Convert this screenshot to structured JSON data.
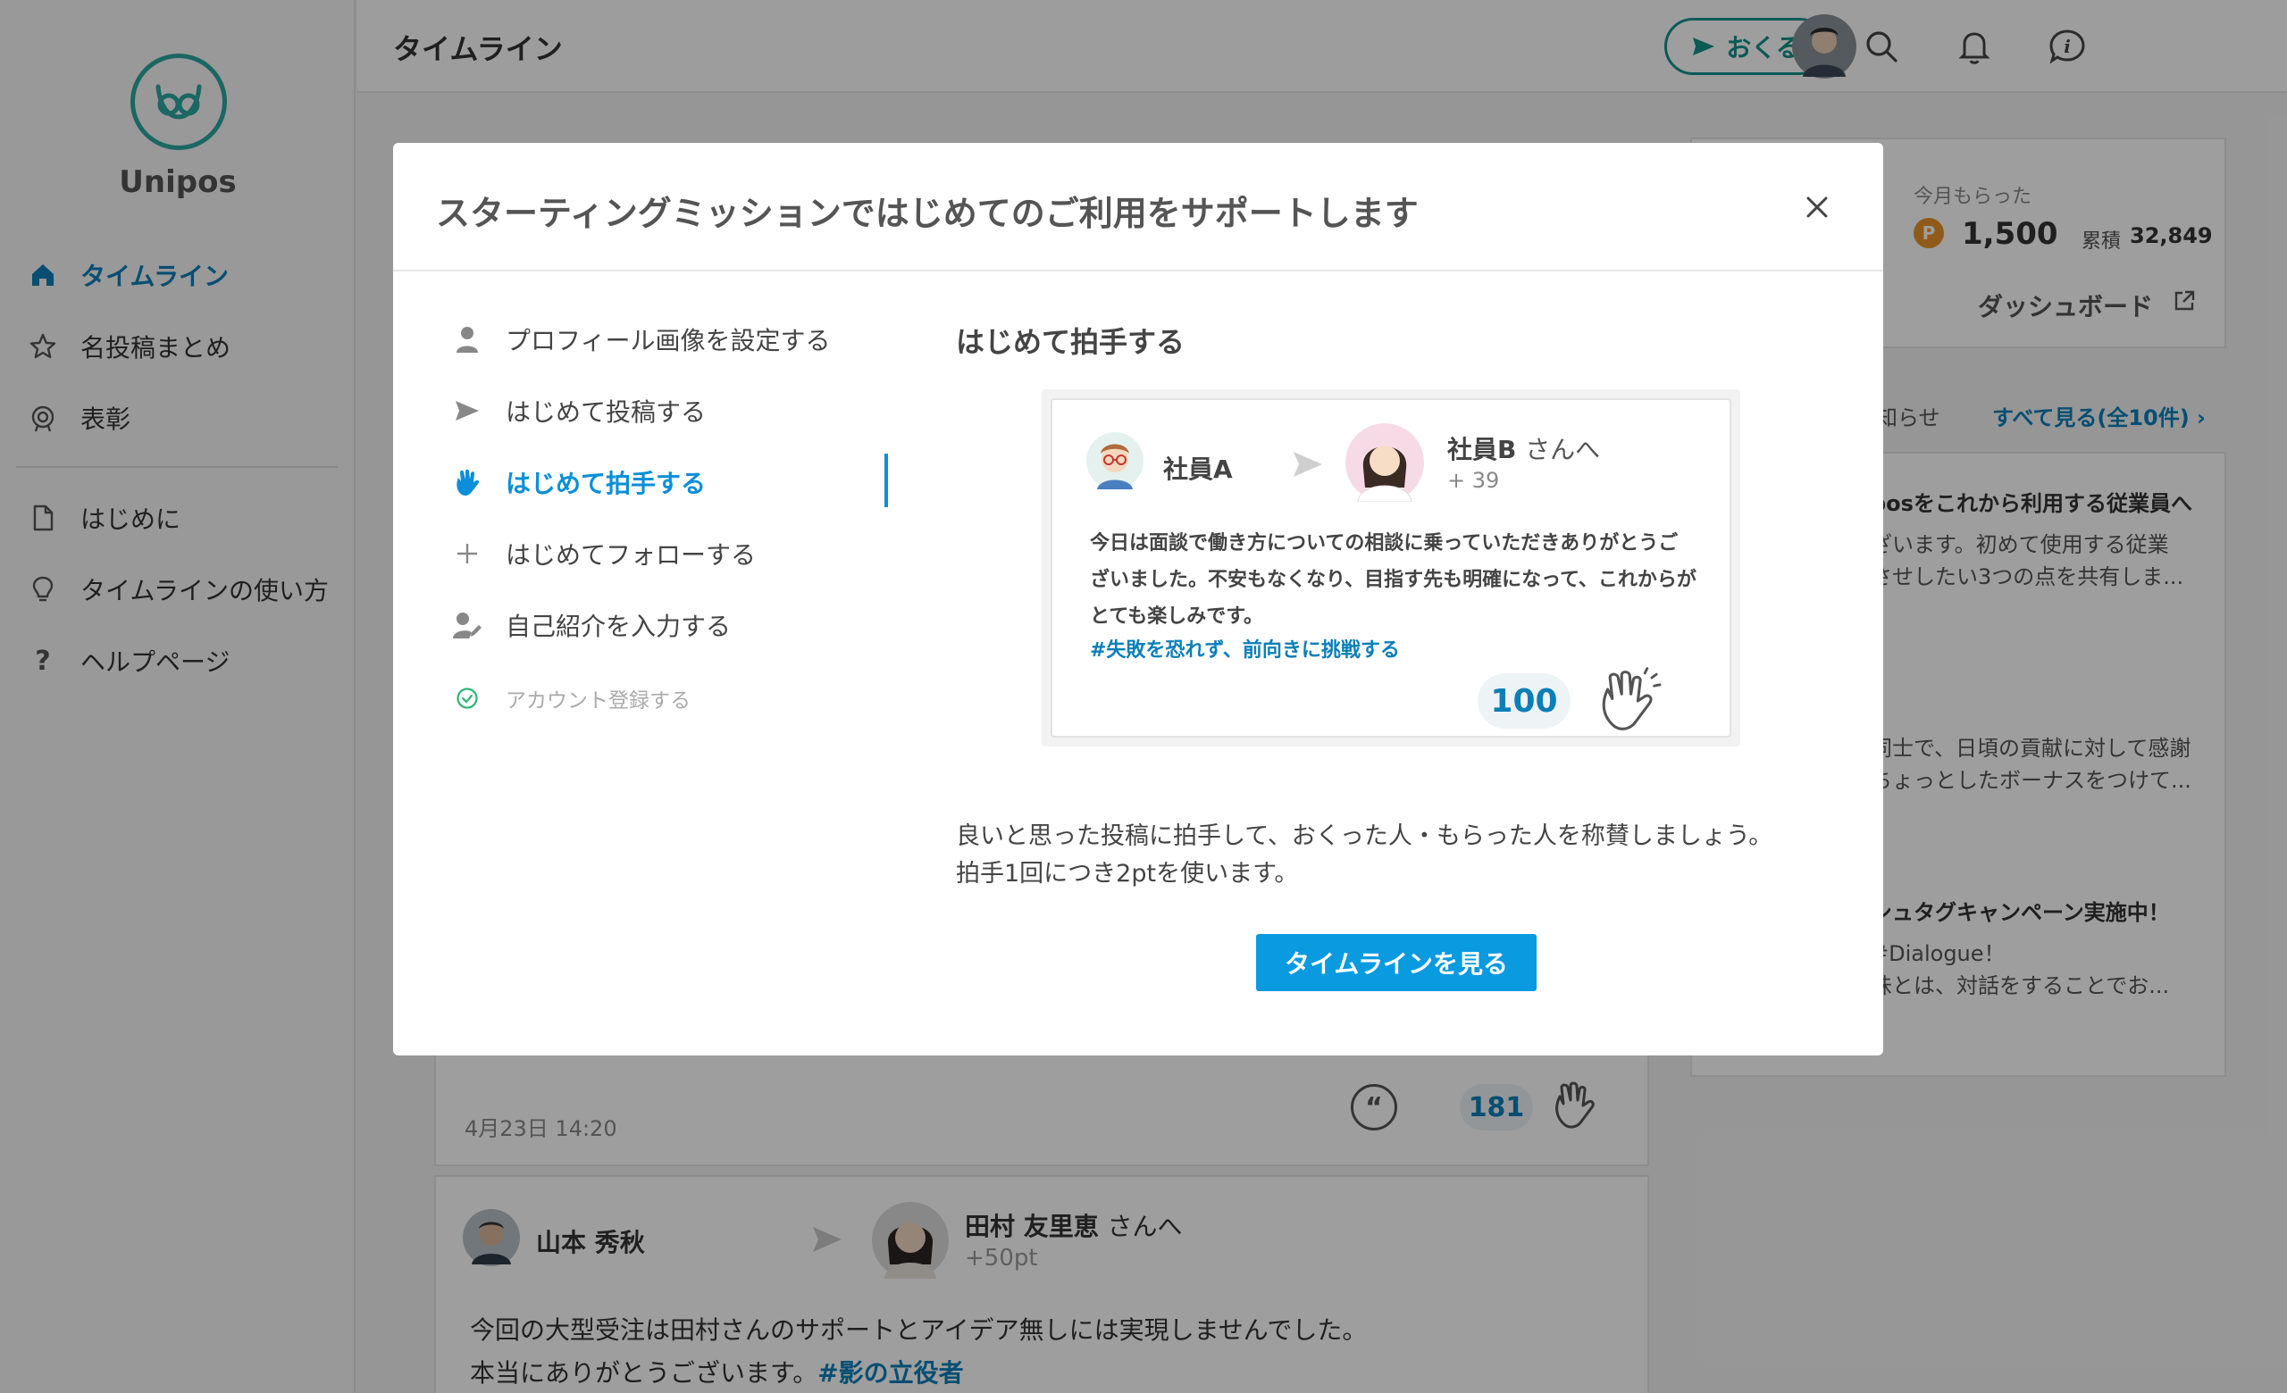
{
  "app": {
    "name": "Unipos"
  },
  "sidebar": {
    "items": [
      {
        "label": "タイムライン",
        "icon": "home-icon",
        "active": true
      },
      {
        "label": "名投稿まとめ",
        "icon": "star-icon"
      },
      {
        "label": "表彰",
        "icon": "award-icon"
      },
      {
        "label": "はじめに",
        "icon": "document-icon"
      },
      {
        "label": "タイムラインの使い方",
        "icon": "lightbulb-icon"
      },
      {
        "label": "ヘルプページ",
        "icon": "question-icon"
      }
    ]
  },
  "header": {
    "title": "タイムライン",
    "send_label": "おくる",
    "icons": [
      "search-icon",
      "bell-icon",
      "info-icon",
      "avatar"
    ]
  },
  "points_card": {
    "label": "今月もらった",
    "point_icon": "P",
    "points": "1,500",
    "total_label": "累積",
    "total": "32,849",
    "dashboard_label": "ダッシュボード"
  },
  "news": {
    "heading": "知らせ",
    "see_all": "すべて見る(全10件)",
    "items": [
      {
        "title": "posをこれから利用する従業員へ",
        "lines": [
          "ざいます。初めて使用する従業",
          "させしたい3つの点を共有しま..."
        ]
      },
      {
        "lines": [
          "同士で、日頃の貢献に対して感謝",
          "ちょっとしたボーナスをつけて..."
        ]
      },
      {
        "title": "シュタグキャンペーン実施中！",
        "lines": [
          "#Dialogue！",
          "味とは、対話をすることでお..."
        ]
      }
    ]
  },
  "feed": {
    "post1": {
      "timestamp": "4月23日 14:20",
      "quote_glyph": "“",
      "claps": "181"
    },
    "post2": {
      "from": "山本 秀秋",
      "to": "田村 友里恵",
      "to_suffix": "さんへ",
      "points": "+50pt",
      "body_line1": "今回の大型受注は田村さんのサポートとアイデア無しには実現しませんでした。",
      "body_line2": "本当にありがとうございます。",
      "tag": "#影の立役者"
    }
  },
  "modal": {
    "title": "スターティングミッションではじめてのご利用をサポートします",
    "missions": [
      {
        "label": "プロフィール画像を設定する",
        "icon": "user-icon"
      },
      {
        "label": "はじめて投稿する",
        "icon": "send-icon"
      },
      {
        "label": "はじめて拍手する",
        "icon": "clap-icon",
        "active": true
      },
      {
        "label": "はじめてフォローする",
        "icon": "plus-icon"
      },
      {
        "label": "自己紹介を入力する",
        "icon": "user-edit-icon"
      },
      {
        "label": "アカウント登録する",
        "icon": "check-circle-icon",
        "done": true
      }
    ],
    "content_title": "はじめて拍手する",
    "example": {
      "from": "社員A",
      "to": "社員B",
      "to_suffix": "さんへ",
      "points": "+ 39",
      "body": "今日は面談で働き方についての相談に乗っていただきありがとうございました。不安もなくなり、目指す先も明確になって、これからがとても楽しみです。",
      "tag": "#失敗を恐れず、前向きに挑戦する",
      "claps": "100"
    },
    "description_line1": "良いと思った投稿に拍手して、おくった人・もらった人を称賛しましょう。",
    "description_line2": "拍手1回につき2ptを使います。",
    "cta_label": "タイムラインを見る"
  },
  "colors": {
    "accent": "#0a9ae0",
    "brand_teal": "#2aa6a0",
    "link": "#0b7fb8",
    "point_orange": "#e8942a"
  }
}
